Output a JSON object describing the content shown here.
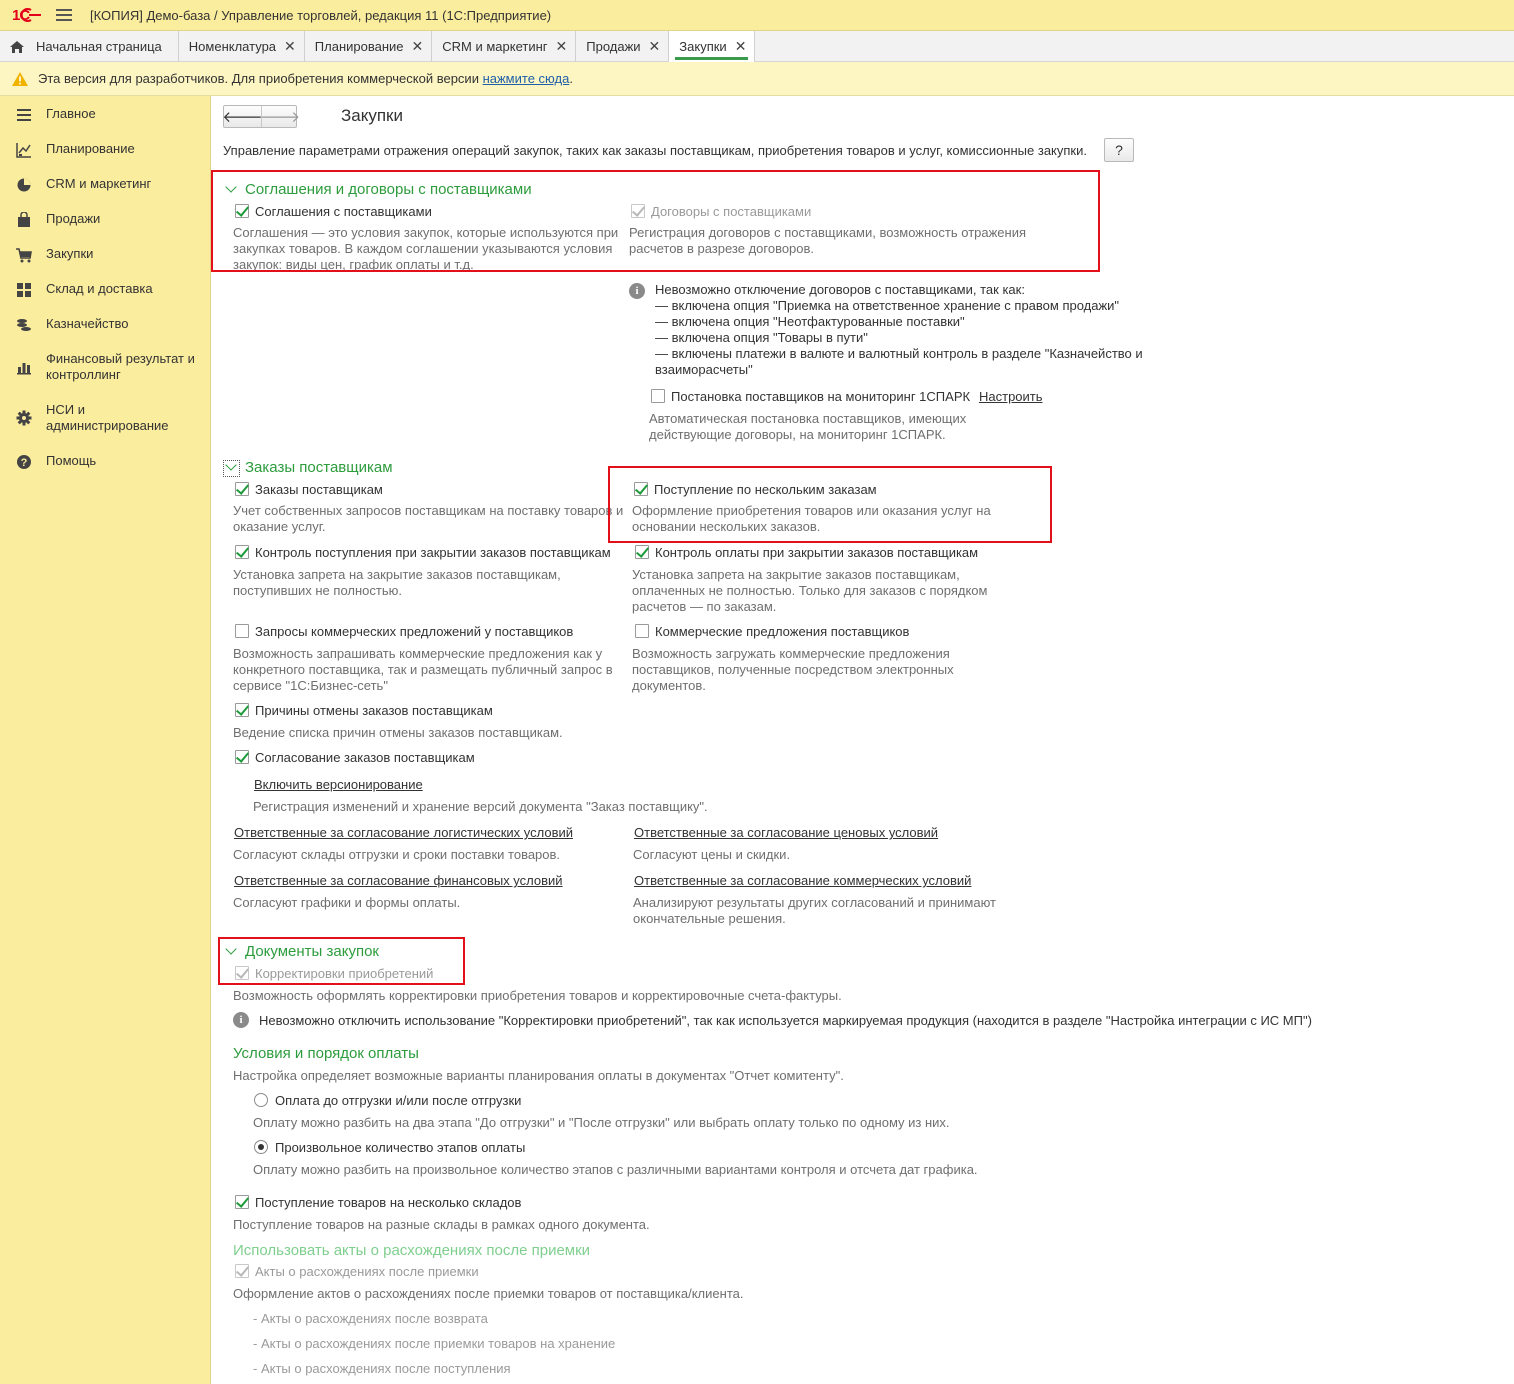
{
  "titlebar": {
    "logo_text": "1С",
    "title": "[КОПИЯ] Демо-база / Управление торговлей, редакция 11  (1С:Предприятие)"
  },
  "tabs": [
    {
      "label": "Начальная страница"
    },
    {
      "label": "Номенклатура"
    },
    {
      "label": "Планирование"
    },
    {
      "label": "CRM и маркетинг"
    },
    {
      "label": "Продажи"
    },
    {
      "label": "Закупки"
    }
  ],
  "close_glyph": "✕",
  "warning": {
    "text": "Эта версия для разработчиков. Для приобретения коммерческой версии ",
    "link": "нажмите сюда",
    "tail": "."
  },
  "sidebar": {
    "items": [
      {
        "label": "Главное",
        "icon": "menu-lines-icon"
      },
      {
        "label": "Планирование",
        "icon": "planning-icon"
      },
      {
        "label": "CRM и маркетинг",
        "icon": "pie-chart-icon"
      },
      {
        "label": "Продажи",
        "icon": "bag-icon"
      },
      {
        "label": "Закупки",
        "icon": "cart-icon"
      },
      {
        "label": "Склад и доставка",
        "icon": "grid-icon"
      },
      {
        "label": "Казначейство",
        "icon": "coins-icon"
      },
      {
        "label": "Финансовый результат и контроллинг",
        "icon": "bar-chart-icon"
      },
      {
        "label": "НСИ и администрирование",
        "icon": "gear-icon"
      },
      {
        "label": "Помощь",
        "icon": "help-circle-icon"
      }
    ]
  },
  "page": {
    "back": "🡐",
    "forward": "🡒",
    "title": "Закупки",
    "description": "Управление параметрами отражения операций закупок, таких как заказы поставщикам, приобретения товаров и услуг, комиссионные закупки.",
    "help": "?"
  },
  "agreements": {
    "header": "Соглашения и договоры с поставщиками",
    "agreements_label": "Соглашения с поставщиками",
    "agreements_desc": "Соглашения — это условия закупок, которые используются при закупках товаров. В каждом соглашении указываются условия закупок: виды цен, график оплаты и т.д.",
    "contracts_label": "Договоры с поставщиками",
    "contracts_desc": "Регистрация договоров с поставщиками, возможность отражения расчетов в разрезе договоров.",
    "info_text": "Невозможно отключение договоров с поставщиками, так как:\n— включена опция \"Приемка на ответственное хранение с правом продажи\"\n— включена опция \"Неотфактурованные поставки\"\n— включена опция \"Товары в пути\"\n— включены платежи в валюте и валютный контроль в разделе \"Казначейство и взаиморасчеты\"",
    "monitoring_label": "Постановка поставщиков на мониторинг 1СПАРК",
    "monitoring_link": "Настроить",
    "monitoring_desc": "Автоматическая постановка поставщиков, имеющих действующие договоры, на мониторинг 1СПАРК."
  },
  "orders": {
    "header": "Заказы поставщикам",
    "orders_label": "Заказы поставщикам",
    "orders_desc": "Учет собственных запросов поставщикам на поставку товаров и оказание услуг.",
    "multi_label": "Поступление по нескольким заказам",
    "multi_desc": "Оформление приобретения товаров или оказания услуг на основании нескольких заказов.",
    "ctrl_receipt_label": "Контроль поступления при закрытии заказов поставщикам",
    "ctrl_receipt_desc": "Установка запрета на закрытие заказов поставщикам, поступивших не полностью.",
    "ctrl_payment_label": "Контроль оплаты при закрытии заказов поставщикам",
    "ctrl_payment_desc": "Установка запрета на закрытие заказов поставщикам, оплаченных не полностью. Только для заказов с порядком расчетов — по заказам.",
    "rfq_label": "Запросы коммерческих предложений у поставщиков",
    "rfq_desc": "Возможность запрашивать коммерческие предложения как у конкретного поставщика, так и размещать публичный запрос в сервисе \"1С:Бизнес-сеть\"",
    "offers_label": "Коммерческие предложения поставщиков",
    "offers_desc": "Возможность загружать коммерческие предложения поставщиков, полученные посредством электронных документов.",
    "cancel_label": "Причины отмены заказов поставщикам",
    "cancel_desc": "Ведение списка причин отмены заказов поставщикам.",
    "approval_label": "Согласование заказов поставщикам",
    "versioning_link": "Включить версионирование",
    "versioning_desc": "Регистрация изменений и хранение версий документа \"Заказ поставщику\".",
    "resp_logistic_link": "Ответственные за согласование логистических условий",
    "resp_logistic_desc": "Согласуют склады отгрузки и сроки поставки товаров.",
    "resp_price_link": "Ответственные за согласование ценовых условий",
    "resp_price_desc": "Согласуют цены и скидки.",
    "resp_fin_link": "Ответственные за согласование финансовых условий",
    "resp_fin_desc": "Согласуют графики и формы оплаты.",
    "resp_comm_link": "Ответственные за согласование коммерческих условий",
    "resp_comm_desc": "Анализируют результаты других согласований и принимают окончательные решения."
  },
  "documents": {
    "header": "Документы закупок",
    "corrections_label": "Корректировки приобретений",
    "corrections_desc": "Возможность оформлять корректировки приобретения товаров и корректировочные счета-фактуры.",
    "corrections_info": "Невозможно отключить использование \"Корректировки приобретений\", так как используется маркируемая продукция (находится в разделе \"Настройка интеграции с ИС МП\")",
    "payment_header": "Условия и порядок оплаты",
    "payment_desc": "Настройка определяет возможные варианты планирования оплаты в документах \"Отчет комитенту\".",
    "radio1_label": "Оплата до отгрузки и/или после отгрузки",
    "radio1_desc": "Оплату можно разбить на два этапа \"До отгрузки\" и \"После отгрузки\" или выбрать оплату только по одному из них.",
    "radio2_label": "Произвольное количество этапов оплаты",
    "radio2_desc": "Оплату можно разбить на произвольное количество этапов с различными вариантами контроля и отсчета дат графика.",
    "warehouses_label": "Поступление товаров на несколько складов",
    "warehouses_desc": "Поступление товаров на разные склады в рамках одного документа.",
    "discrepancy_header": "Использовать акты о расхождениях после приемки",
    "discrepancy_label": "Акты о расхождениях после приемки",
    "discrepancy_desc": "Оформление актов о расхождениях после приемки товаров от поставщика/клиента.",
    "sub1": "- Акты о расхождениях после возврата",
    "sub2": "- Акты о расхождениях после приемки товаров на хранение",
    "sub3": "- Акты о расхождениях после поступления"
  },
  "colors": {
    "accent_green": "#2d9c3d",
    "highlight_red": "#e3101a",
    "sidebar_yellow": "#fbed9e"
  }
}
